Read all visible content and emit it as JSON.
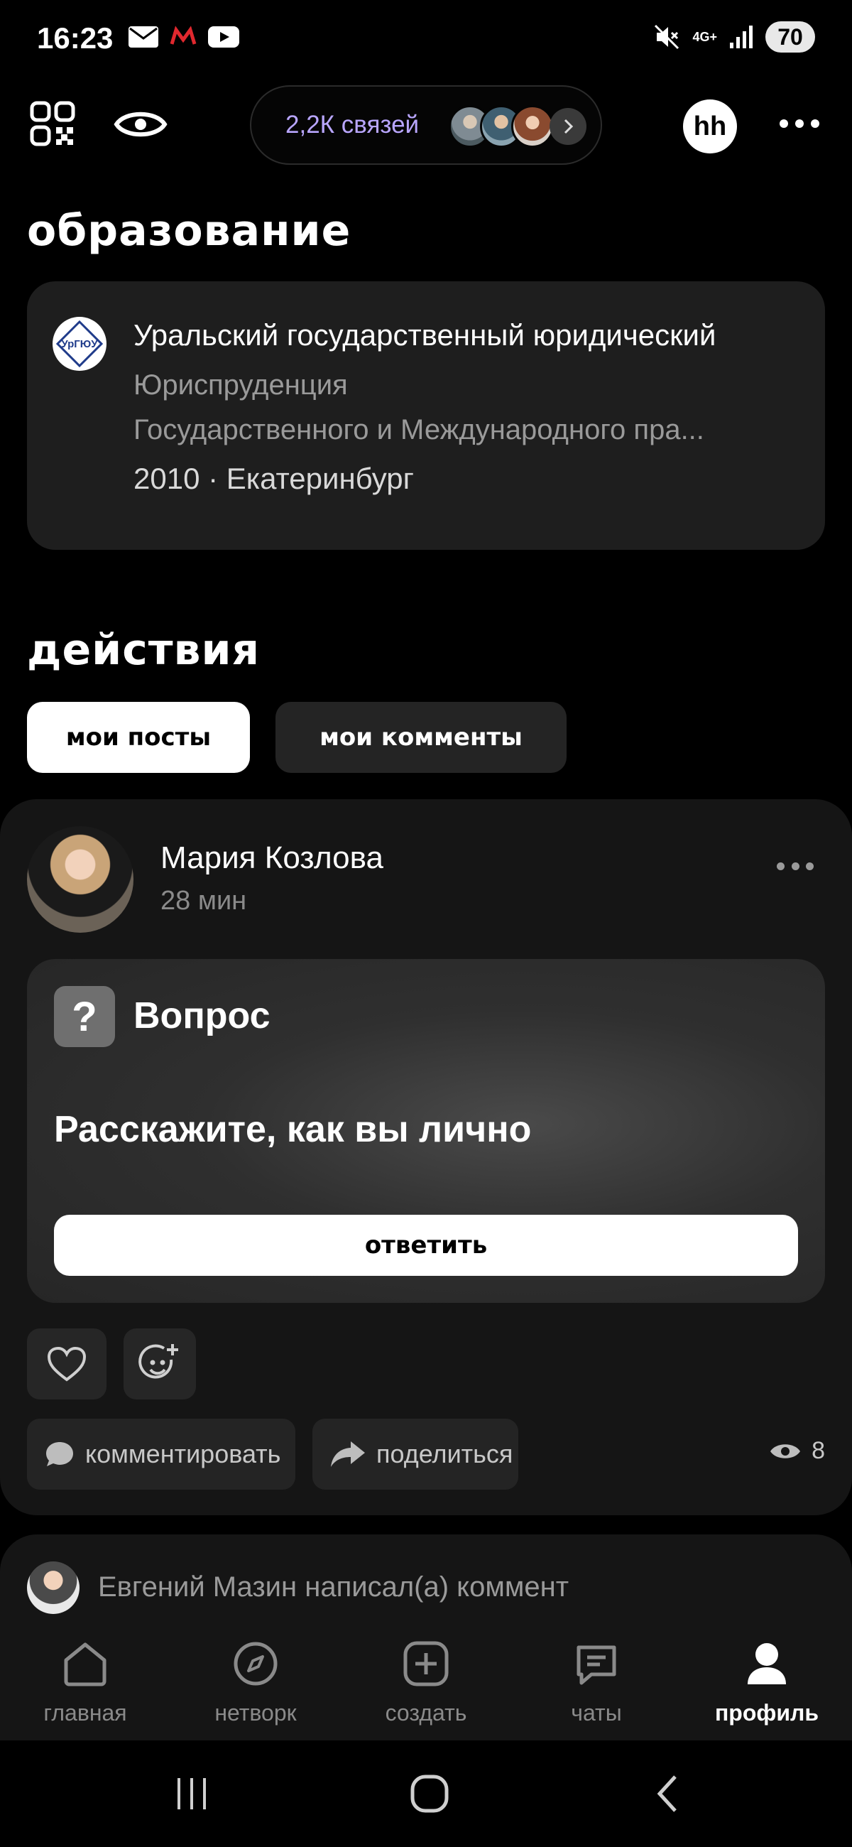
{
  "status": {
    "time": "16:23",
    "network": "4G+",
    "battery": "70"
  },
  "topbar": {
    "connections_label": "2,2К связей"
  },
  "education": {
    "heading": "образование",
    "university": "Уральский государственный юридический",
    "faculty": "Юриспруденция",
    "department": "Государственного и Международного пра...",
    "meta": "2010 · Екатеринбург",
    "logo_text": "УрГЮУ"
  },
  "actions": {
    "heading": "действия",
    "tabs": [
      {
        "label": "мои посты",
        "active": true
      },
      {
        "label": "мои комменты",
        "active": false
      }
    ]
  },
  "post": {
    "author": "Мария Козлова",
    "time": "28 мин",
    "type_label": "Вопрос",
    "question": "Расскажите, как вы лично",
    "answer_label": "ответить",
    "comment_label": "комментировать",
    "share_label": "поделиться",
    "views": "8"
  },
  "next_post": {
    "text": "Евгений Мазин написал(а) коммент"
  },
  "bottom_nav": {
    "items": [
      {
        "label": "главная",
        "icon": "home-icon"
      },
      {
        "label": "нетворк",
        "icon": "compass-icon"
      },
      {
        "label": "создать",
        "icon": "plus-square-icon"
      },
      {
        "label": "чаты",
        "icon": "chat-icon"
      },
      {
        "label": "профиль",
        "icon": "profile-icon",
        "active": true
      }
    ]
  },
  "colors": {
    "background": "#000000",
    "card": "#1e1e1e",
    "accent_purple": "#b9a6ff"
  }
}
